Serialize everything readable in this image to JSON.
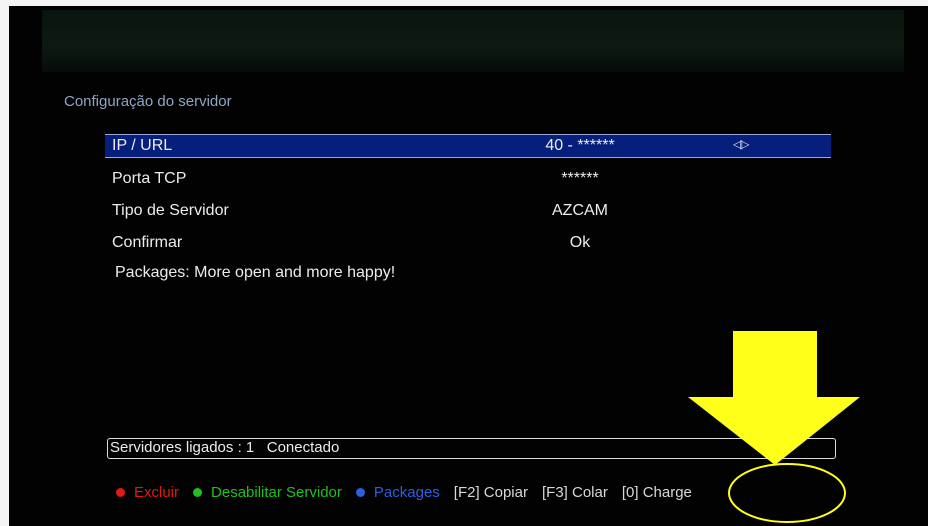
{
  "screen_title": "Configuração do servidor",
  "menu": [
    {
      "label": "IP / URL",
      "value": "40 - ******",
      "arrows": "◁▷"
    },
    {
      "label": "Porta TCP",
      "value": "******"
    },
    {
      "label": "Tipo de Servidor",
      "value": "AZCAM"
    },
    {
      "label": "Confirmar",
      "value": "Ok"
    }
  ],
  "info_text": "Packages: More open and more happy!",
  "status": {
    "text": "Servidores ligados : 1   Conectado"
  },
  "legend": {
    "red": {
      "label": "Excluir",
      "color": "#e01818"
    },
    "green": {
      "label": "Desabilitar Servidor",
      "color": "#20c020"
    },
    "blue": {
      "label": "Packages",
      "color": "#2f5fe0"
    },
    "f2": "[F2] Copiar",
    "f3": "[F3] Colar",
    "zero": "[0] Charge"
  },
  "highlight_color": "#ffff1a"
}
